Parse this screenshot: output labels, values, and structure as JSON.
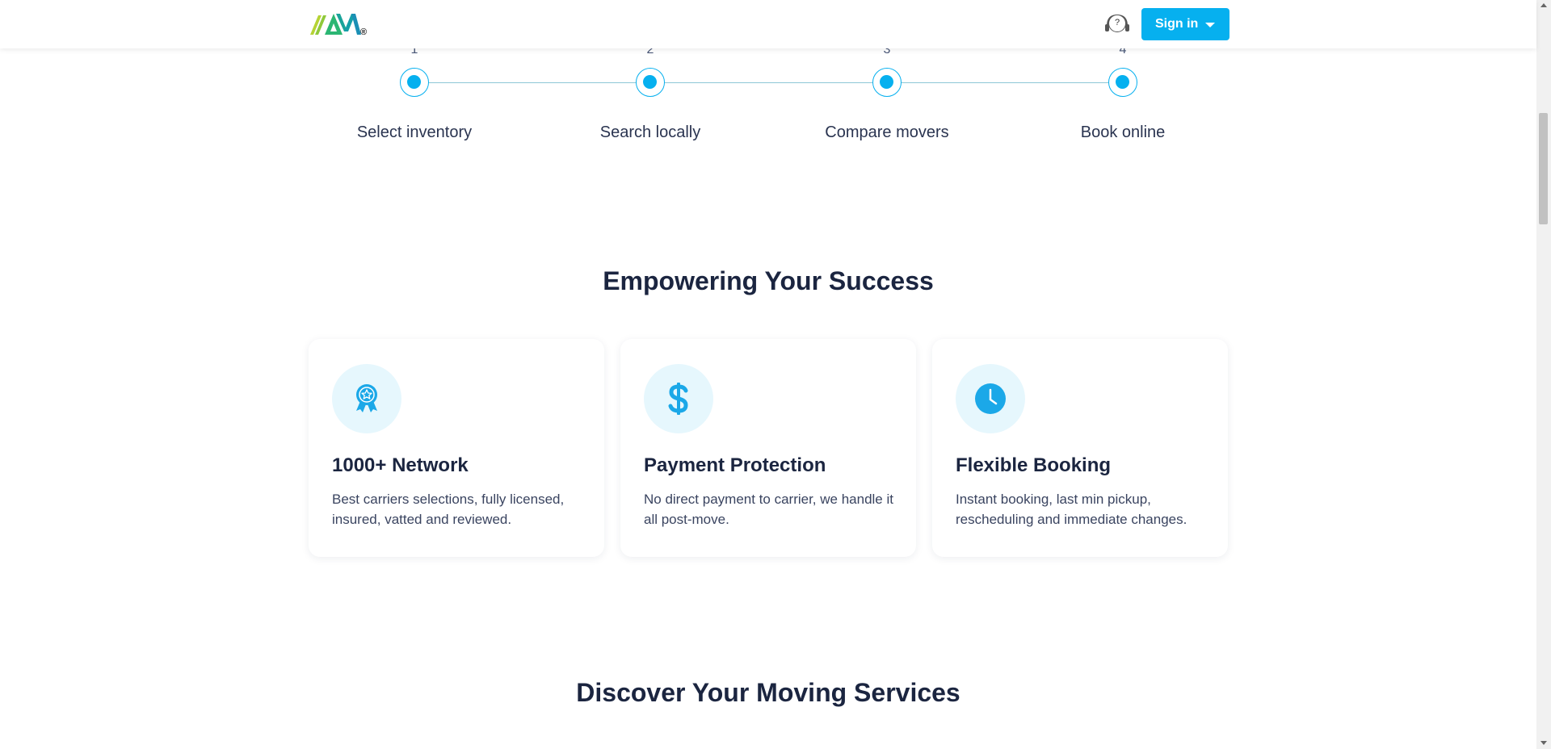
{
  "header": {
    "logo_mark": "®",
    "support_glyph": "?",
    "signin_label": "Sign in"
  },
  "steps": [
    {
      "number": "1",
      "label": "Select inventory"
    },
    {
      "number": "2",
      "label": "Search locally"
    },
    {
      "number": "3",
      "label": "Compare movers"
    },
    {
      "number": "4",
      "label": "Book online"
    }
  ],
  "features": {
    "title": "Empowering Your Success",
    "cards": [
      {
        "icon": "award-badge-icon",
        "title": "1000+ Network",
        "text": "Best carriers selections, fully licensed, insured, vatted and reviewed."
      },
      {
        "icon": "dollar-icon",
        "title": "Payment Protection",
        "text": "No direct payment to carrier, we handle it all post-move."
      },
      {
        "icon": "clock-icon",
        "title": "Flexible Booking",
        "text": "Instant booking, last min pickup, rescheduling and immediate changes."
      }
    ]
  },
  "services": {
    "title": "Discover Your Moving Services"
  },
  "colors": {
    "accent": "#06b0ef",
    "heading": "#1b2540",
    "icon_bg": "#e6f7fd"
  }
}
